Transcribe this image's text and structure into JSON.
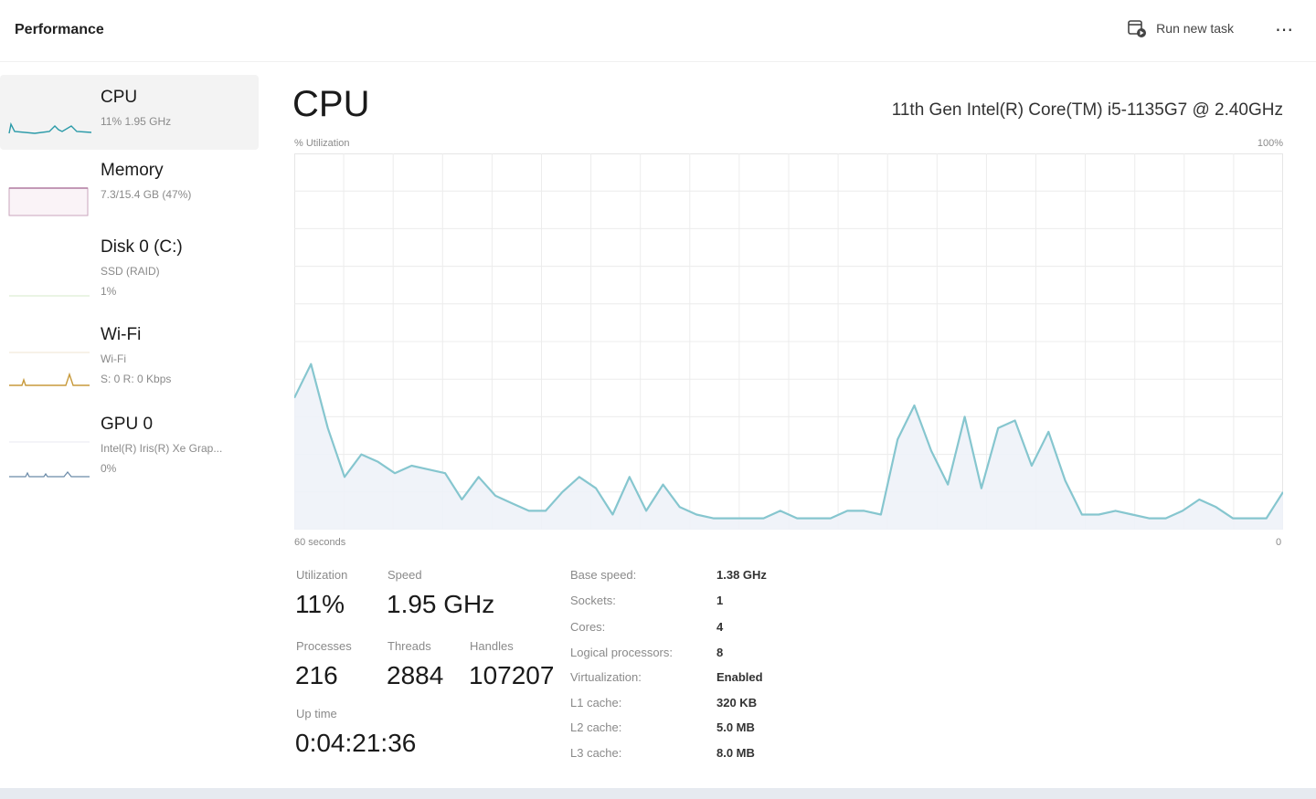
{
  "header": {
    "title": "Performance",
    "run_task_label": "Run new task",
    "more_label": "⋯"
  },
  "sidebar": {
    "items": [
      {
        "name": "CPU",
        "sub1": "11% 1.95 GHz",
        "sub2": ""
      },
      {
        "name": "Memory",
        "sub1": "7.3/15.4 GB (47%)",
        "sub2": ""
      },
      {
        "name": "Disk 0 (C:)",
        "sub1": "SSD (RAID)",
        "sub2": "1%"
      },
      {
        "name": "Wi-Fi",
        "sub1": "Wi-Fi",
        "sub2": "S: 0 R: 0 Kbps"
      },
      {
        "name": "GPU 0",
        "sub1": "Intel(R) Iris(R) Xe Grap...",
        "sub2": "0%"
      }
    ]
  },
  "main": {
    "title": "CPU",
    "cpu_model": "11th Gen Intel(R) Core(TM) i5-1135G7 @ 2.40GHz",
    "util_label": "% Utilization",
    "util_max": "100%",
    "time_left": "60 seconds",
    "time_right": "0"
  },
  "stats": {
    "utilization_label": "Utilization",
    "utilization_value": "11%",
    "speed_label": "Speed",
    "speed_value": "1.95 GHz",
    "processes_label": "Processes",
    "processes_value": "216",
    "threads_label": "Threads",
    "threads_value": "2884",
    "handles_label": "Handles",
    "handles_value": "107207",
    "uptime_label": "Up time",
    "uptime_value": "0:04:21:36"
  },
  "specs": [
    {
      "label": "Base speed:",
      "value": "1.38 GHz"
    },
    {
      "label": "Sockets:",
      "value": "1"
    },
    {
      "label": "Cores:",
      "value": "4"
    },
    {
      "label": "Logical processors:",
      "value": "8"
    },
    {
      "label": "Virtualization:",
      "value": "Enabled"
    },
    {
      "label": "L1 cache:",
      "value": "320 KB"
    },
    {
      "label": "L2 cache:",
      "value": "5.0 MB"
    },
    {
      "label": "L3 cache:",
      "value": "8.0 MB"
    }
  ],
  "chart_data": {
    "type": "area",
    "xlim": [
      60,
      0
    ],
    "ylim": [
      0,
      100
    ],
    "grid": true,
    "series": [
      {
        "values": [
          35,
          44,
          27,
          14,
          20,
          18,
          15,
          17,
          16,
          15,
          8,
          14,
          9,
          7,
          5,
          5,
          10,
          14,
          11,
          4,
          14,
          5,
          12,
          6,
          4,
          3,
          3,
          3,
          3,
          5,
          3,
          3,
          3,
          5,
          5,
          4,
          24,
          33,
          21,
          12,
          30,
          11,
          27,
          29,
          17,
          26,
          13,
          4,
          4,
          5,
          4,
          3,
          3,
          5,
          8,
          6,
          3,
          3,
          3,
          10
        ]
      }
    ],
    "colors": {
      "line": "#86c6cf",
      "fill": "#eef2f8",
      "grid": "#ececec"
    }
  }
}
